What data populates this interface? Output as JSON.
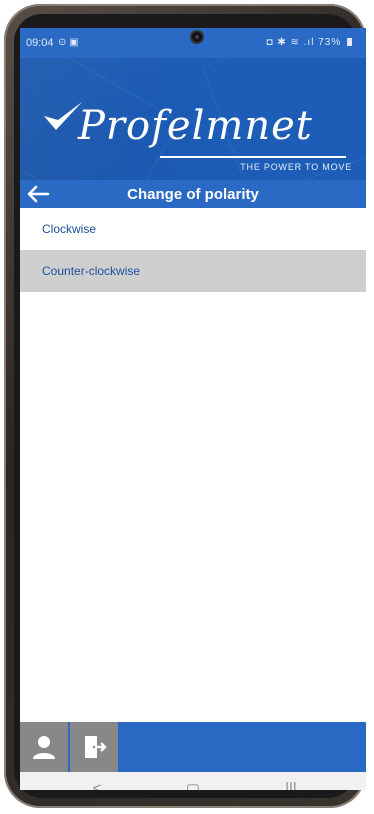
{
  "status_bar": {
    "time": "09:04",
    "left_icons": "⊙ ▣",
    "right_icons": "◘ ✱ ≋ .ıl",
    "battery": "73%"
  },
  "brand": {
    "logo_text": "Profelmnet",
    "tagline": "THE POWER TO MOVE"
  },
  "header": {
    "title": "Change of polarity",
    "back_icon": "arrow-left-icon"
  },
  "options": [
    {
      "label": "Clockwise",
      "selected": false
    },
    {
      "label": "Counter-clockwise",
      "selected": true
    }
  ],
  "bottom_bar": {
    "user_icon": "user-icon",
    "exit_icon": "exit-door-icon"
  },
  "nav_bar": {
    "back": "<",
    "home": "▢",
    "recents": "|||"
  },
  "colors": {
    "primary": "#2a6ac4",
    "banner": "#1d5db8",
    "link": "#1e4f9c",
    "selected_row": "#cfcfcf",
    "bottom_button": "#888888"
  }
}
